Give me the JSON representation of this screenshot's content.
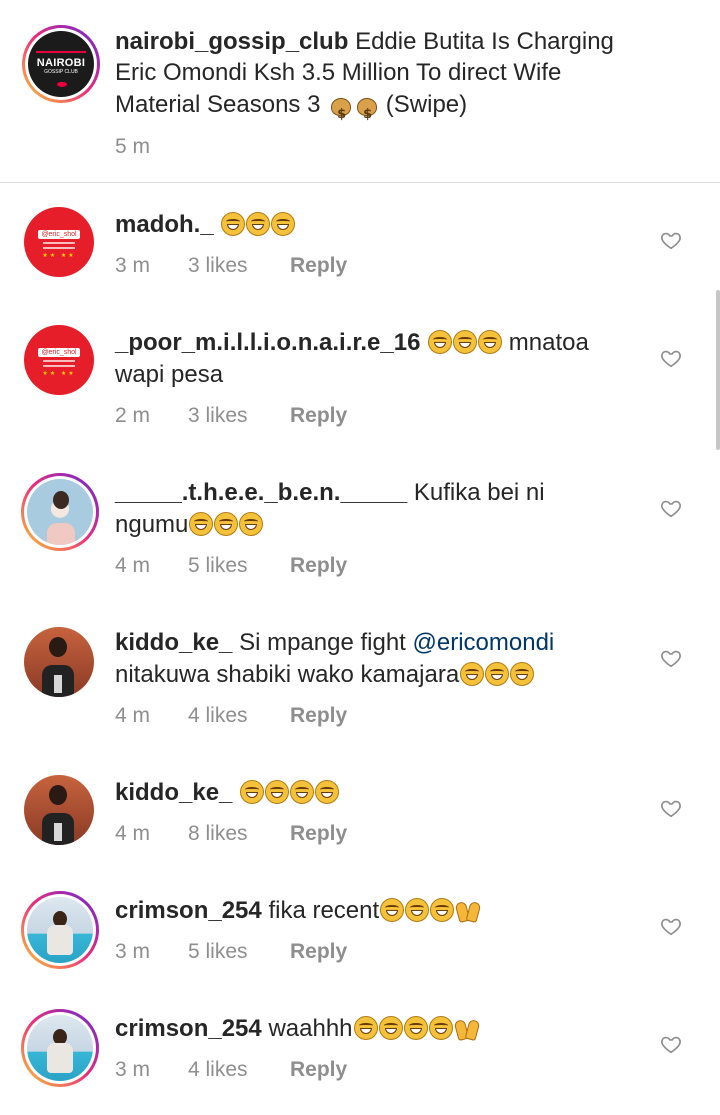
{
  "post": {
    "username": "nairobi_gossip_club",
    "logo_text": "NAIROBI",
    "logo_sub": "GOSSIP CLUB",
    "caption_line1": "Eddie Butita Is Charging",
    "caption_line2": "Eric Omondi Ksh 3.5 Million To direct Wife",
    "caption_line3a": "Material Seasons 3",
    "caption_line3b": "(Swipe)",
    "time": "5 m"
  },
  "comments": [
    {
      "username": "madoh._",
      "text": "",
      "avatar_tag": "@eric_shol",
      "time": "3 m",
      "likes": "3 likes",
      "reply": "Reply"
    },
    {
      "username": "_poor_m.i.l.l.i.o.n.a.i.r.e_16",
      "text": "mnatoa",
      "text2": "wapi pesa",
      "avatar_tag": "@eric_shol",
      "time": "2 m",
      "likes": "3 likes",
      "reply": "Reply"
    },
    {
      "username": "_____.t.h.e.e._b.e.n._____",
      "text": "Kufika bei ni",
      "text2": "ngumu",
      "time": "4 m",
      "likes": "5 likes",
      "reply": "Reply"
    },
    {
      "username": "kiddo_ke_",
      "text": "Si mpange fight",
      "mention": "@ericomondi",
      "text2": "nitakuwa shabiki wako kamajara",
      "time": "4 m",
      "likes": "4 likes",
      "reply": "Reply"
    },
    {
      "username": "kiddo_ke_",
      "text": "",
      "time": "4 m",
      "likes": "8 likes",
      "reply": "Reply"
    },
    {
      "username": "crimson_254",
      "text": "fika recent",
      "time": "3 m",
      "likes": "5 likes",
      "reply": "Reply"
    },
    {
      "username": "crimson_254",
      "text": "waahhh",
      "time": "3 m",
      "likes": "4 likes",
      "reply": "Reply"
    }
  ],
  "icons": {
    "like": "heart-outline-icon",
    "laugh": "face-with-tears-of-joy-emoji",
    "money": "money-bag-emoji",
    "hands": "raising-hands-emoji"
  },
  "colors": {
    "username": "#262626",
    "meta": "#8e8e8e",
    "mention": "#00376b",
    "divider": "#dbdbdb"
  }
}
